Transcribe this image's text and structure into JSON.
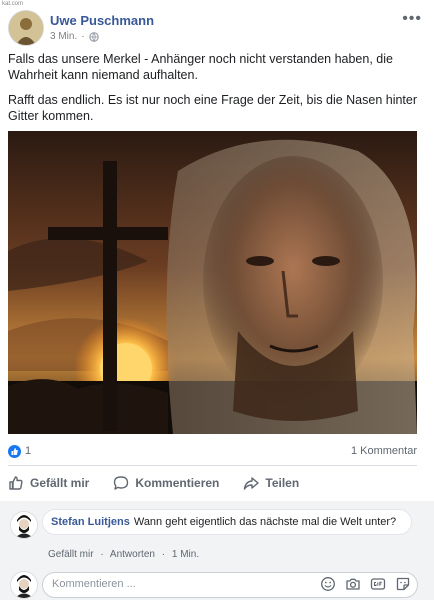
{
  "watermark": "kat.com",
  "post": {
    "author": "Uwe Puschmann",
    "time": "3 Min.",
    "separator": "·",
    "more_label": "•••",
    "paragraphs": [
      "Falls das unsere Merkel - Anhänger noch nicht verstanden haben, die Wahrheit kann niemand aufhalten.",
      "Rafft das endlich. Es ist nur noch eine Frage der Zeit, bis die Nasen hinter Gitter kommen."
    ],
    "like_count": "1",
    "comment_count": "1 Kommentar"
  },
  "actions": {
    "like": "Gefällt mir",
    "comment": "Kommentieren",
    "share": "Teilen"
  },
  "comment": {
    "author": "Stefan Luitjens",
    "text": "Wann geht eigentlich das nächste mal die Welt unter?",
    "like_link": "Gefällt mir",
    "reply_link": "Antworten",
    "time": "1 Min.",
    "dot": "·"
  },
  "reply": {
    "placeholder": "Kommentieren ..."
  },
  "icons": [
    "globe-icon",
    "like-icon",
    "comment-icon",
    "share-icon",
    "emoji-icon",
    "camera-icon",
    "gif-icon",
    "sticker-icon"
  ],
  "colors": {
    "accent": "#385898",
    "like_blue": "#1877f2"
  }
}
